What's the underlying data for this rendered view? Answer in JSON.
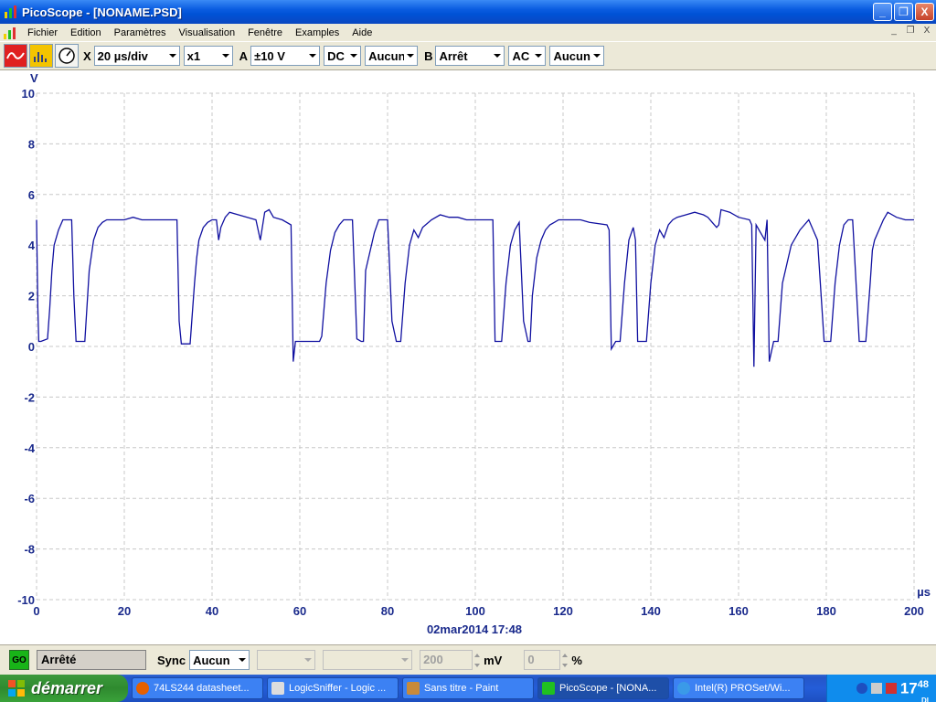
{
  "window": {
    "title": "PicoScope - [NONAME.PSD]",
    "minimize": "_",
    "maximize": "❐",
    "close": "X"
  },
  "menu": {
    "items": [
      "Fichier",
      "Edition",
      "Paramètres",
      "Visualisation",
      "Fenêtre",
      "Examples",
      "Aide"
    ]
  },
  "toolbar": {
    "x_label": "X",
    "timebase": "20 µs/div",
    "multiplier": "x1",
    "a_label": "A",
    "a_range": "±10 V",
    "a_coupling": "DC",
    "a_option": "Aucun",
    "b_label": "B",
    "b_range": "Arrêt",
    "b_coupling": "AC",
    "b_option": "Aucun"
  },
  "chart_data": {
    "type": "line",
    "ylabel": "V",
    "xlabel": "µs",
    "ylim": [
      -10,
      10
    ],
    "xlim": [
      0,
      200
    ],
    "yticks": [
      "10",
      "8",
      "6",
      "4",
      "2",
      "0",
      "-2",
      "-4",
      "-6",
      "-8",
      "-10"
    ],
    "xticks": [
      "0",
      "20",
      "40",
      "60",
      "80",
      "100",
      "120",
      "140",
      "160",
      "180",
      "200"
    ],
    "timestamp": "02mar2014  17:48",
    "grid": true,
    "line_color": "#1010a0",
    "series": [
      {
        "x": [
          0,
          0.3,
          0.5,
          1,
          2.5,
          3,
          3.5,
          4,
          5,
          6,
          7,
          8,
          8.5,
          9,
          9.5,
          10,
          11,
          12,
          13,
          14,
          15,
          16,
          18,
          20,
          22,
          24,
          26,
          28,
          30,
          32,
          32.5,
          33,
          34,
          35,
          36,
          36.5,
          37,
          38,
          39,
          40,
          41,
          41.5,
          42,
          43,
          44,
          46,
          48,
          50,
          50.5,
          51,
          52,
          53,
          54,
          56,
          58,
          58.5,
          59,
          60,
          61,
          63,
          64.5,
          65,
          66,
          67,
          68,
          69,
          70,
          71,
          72,
          73,
          74,
          74.5,
          75,
          77,
          78,
          79,
          80,
          81,
          82,
          83,
          84,
          85,
          86,
          87,
          88,
          90,
          92,
          94,
          96,
          98,
          100,
          104,
          104.5,
          105,
          106,
          107,
          108,
          109,
          110,
          111,
          112,
          112.5,
          113,
          114,
          115,
          116,
          117,
          118,
          119,
          120,
          122,
          124,
          126,
          130,
          130.5,
          131,
          132,
          133,
          134,
          135,
          136,
          136.5,
          137,
          138,
          139,
          140,
          141,
          142,
          143,
          144,
          145,
          146,
          148,
          150,
          152,
          153,
          154,
          155,
          155.5,
          156,
          158,
          160,
          162.5,
          163,
          163.5,
          164,
          165,
          166,
          166.5,
          167,
          168,
          169,
          170,
          172,
          174,
          175,
          176,
          178,
          179.5,
          180,
          181,
          182,
          183,
          184,
          185,
          186,
          187.5,
          188,
          189,
          190,
          190.5,
          191,
          192,
          193,
          194,
          196,
          198,
          200
        ],
        "y": [
          5,
          1.5,
          0.2,
          0.2,
          0.3,
          1.5,
          3,
          4,
          4.6,
          5,
          5,
          5,
          2,
          0.2,
          0.2,
          0.2,
          0.2,
          3,
          4.2,
          4.7,
          4.9,
          5,
          5,
          5,
          5.1,
          5,
          5,
          5,
          5,
          5,
          1,
          0.1,
          0.1,
          0.1,
          2.5,
          3.5,
          4.2,
          4.7,
          4.9,
          5,
          5,
          4.2,
          4.7,
          5.1,
          5.3,
          5.2,
          5.1,
          5,
          4.6,
          4.2,
          5.3,
          5.4,
          5.1,
          5,
          4.8,
          -0.6,
          0.2,
          0.2,
          0.2,
          0.2,
          0.2,
          0.4,
          2.5,
          3.8,
          4.5,
          4.8,
          5,
          5,
          5,
          0.3,
          0.2,
          0.2,
          3,
          4.5,
          5,
          5,
          5,
          1,
          0.2,
          0.2,
          2.5,
          4,
          4.6,
          4.3,
          4.7,
          5,
          5.2,
          5.1,
          5.1,
          5,
          5,
          5,
          0.2,
          0.2,
          0.2,
          2.5,
          4,
          4.6,
          4.9,
          1,
          0.2,
          0.2,
          2,
          3.5,
          4.2,
          4.6,
          4.8,
          4.9,
          5,
          5,
          5,
          5,
          4.9,
          4.8,
          4.6,
          -0.1,
          0.2,
          0.2,
          2.5,
          4.2,
          4.7,
          4.2,
          0.2,
          0.2,
          0.2,
          2.5,
          4,
          4.6,
          4.3,
          4.8,
          5,
          5.1,
          5.2,
          5.3,
          5.2,
          5.1,
          4.9,
          4.7,
          4.8,
          5.4,
          5.3,
          5.1,
          5,
          4.8,
          -0.8,
          4.8,
          4.5,
          4.2,
          5,
          -0.6,
          0.2,
          0.2,
          2.5,
          4,
          4.6,
          4.8,
          5,
          4.2,
          0.2,
          0.2,
          0.2,
          2.5,
          4,
          4.8,
          5,
          5,
          0.2,
          0.2,
          0.2,
          2.5,
          3.8,
          4.2,
          4.6,
          5,
          5.3,
          5.1,
          5,
          5
        ]
      }
    ]
  },
  "statusbar": {
    "go": "GO",
    "state": "Arrêté",
    "sync_label": "Sync",
    "sync_value": "Aucun",
    "level": "200",
    "level_unit": "mV",
    "percent": "0",
    "percent_unit": "%"
  },
  "taskbar": {
    "start": "démarrer",
    "tasks": [
      "74LS244 datasheet...",
      "LogicSniffer - Logic ...",
      "Sans titre - Paint",
      "PicoScope - [NONA...",
      "Intel(R) PROSet/Wi..."
    ],
    "clock_hour": "17",
    "clock_min": "48",
    "clock_suffix": "DI"
  }
}
